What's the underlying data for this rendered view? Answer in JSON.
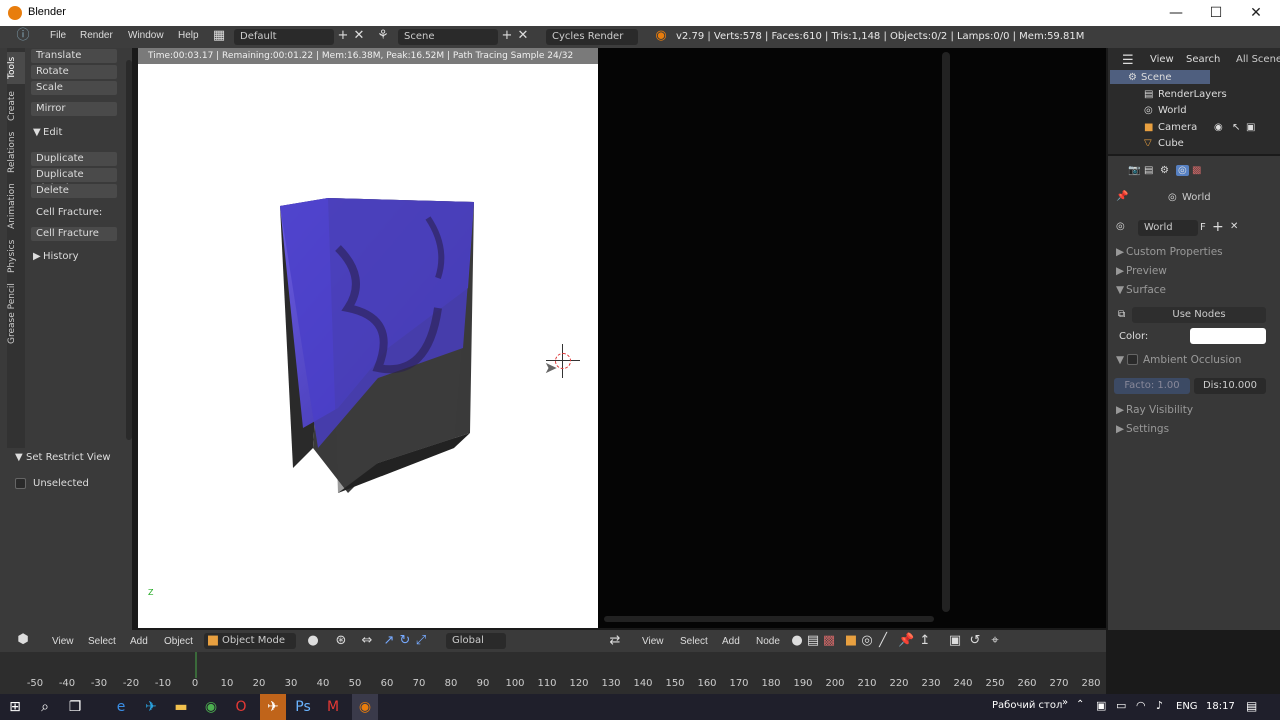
{
  "window": {
    "title": "Blender",
    "min": "—",
    "max": "☐",
    "close": "✕"
  },
  "menubar": {
    "items": [
      "File",
      "Render",
      "Window",
      "Help"
    ],
    "screen_layout": "Default",
    "scene": "Scene",
    "engine": "Cycles Render",
    "stats": "v2.79 | Verts:578 | Faces:610 | Tris:1,148 | Objects:0/2 | Lamps:0/0 | Mem:59.81M"
  },
  "tool_tabs": [
    "Tools",
    "Create",
    "Relations",
    "Animation",
    "Physics",
    "Grease Pencil"
  ],
  "tools": {
    "transform": [
      "Translate",
      "Rotate",
      "Scale"
    ],
    "mirror": "Mirror",
    "edit_header": "Edit",
    "edit_items": [
      "Duplicate",
      "Duplicate Linked",
      "Delete"
    ],
    "cell_fracture_label": "Cell Fracture:",
    "cell_fracture_button": "Cell Fracture",
    "history": "History",
    "restrict_header": "Set Restrict View",
    "unselected": "Unselected"
  },
  "viewport": {
    "render_status": "Time:00:03.17 | Remaining:00:01.22 | Mem:16.38M, Peak:16.52M | Path Tracing Sample 24/32",
    "axis_z": "Z"
  },
  "outliner": {
    "header": [
      "View",
      "Search",
      "All Scenes"
    ],
    "items": [
      "Scene",
      "RenderLayers",
      "World",
      "Camera",
      "Cube"
    ]
  },
  "properties": {
    "breadcrumb": "World",
    "world_field": "World",
    "world_flag": "F",
    "panels": [
      "Custom Properties",
      "Preview",
      "Surface"
    ],
    "use_nodes": "Use Nodes",
    "color_label": "Color:",
    "color_value": "#ffffff",
    "ambient_occlusion": "Ambient Occlusion",
    "factor": "Facto: 1.00",
    "distance": "Dis:10.000",
    "ray_visibility": "Ray Visibility",
    "settings": "Settings"
  },
  "view3d_header": {
    "menus": [
      "View",
      "Select",
      "Add",
      "Object"
    ],
    "mode": "Object Mode",
    "orientation": "Global"
  },
  "node_header": {
    "menus": [
      "View",
      "Select",
      "Add",
      "Node"
    ]
  },
  "timeline": {
    "ticks": [
      "-50",
      "-40",
      "-30",
      "-20",
      "-10",
      "0",
      "10",
      "20",
      "30",
      "40",
      "50",
      "60",
      "70",
      "80",
      "90",
      "100",
      "110",
      "120",
      "130",
      "140",
      "150",
      "160",
      "170",
      "180",
      "190",
      "200",
      "210",
      "220",
      "230",
      "240",
      "250",
      "260",
      "270",
      "280"
    ]
  },
  "taskbar": {
    "desktop_label": "Рабочий стол",
    "lang": "ENG",
    "time": "18:17"
  },
  "colors": {
    "accent": "#5680c2",
    "blender_orange": "#e87d0d",
    "cube_blue": "#5a4fd8"
  }
}
